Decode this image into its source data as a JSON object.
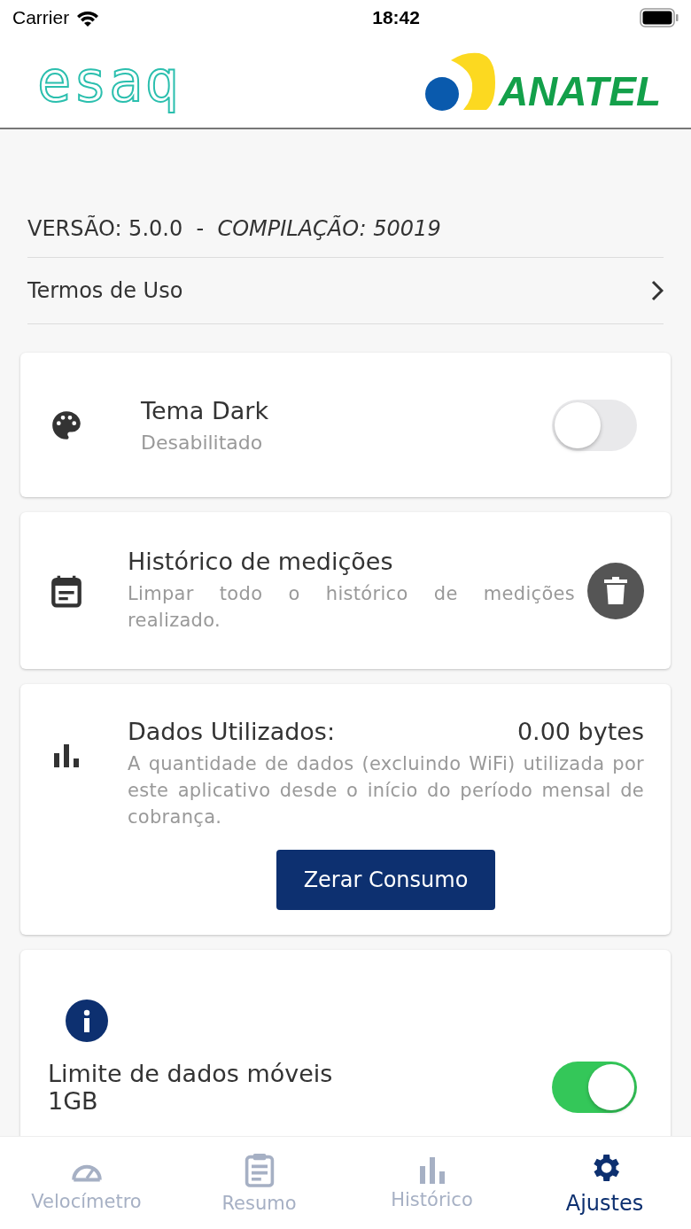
{
  "status_bar": {
    "carrier": "Carrier",
    "time": "18:42"
  },
  "header": {
    "left_logo": "esaq",
    "right_logo": "ANATEL"
  },
  "version": {
    "version": "VERSÃO: 5.0.0",
    "separator": "-",
    "build": "COMPILAÇÃO: 50019"
  },
  "terms": {
    "label": "Termos de Uso"
  },
  "cards": [
    {
      "kind": "toggle",
      "title": "Tema Dark",
      "subtitle": "Desabilitado",
      "on": false
    },
    {
      "kind": "delete",
      "title": "Histórico de medições",
      "description": "Limpar todo o histórico de medições realizado."
    },
    {
      "kind": "data",
      "title": "Dados Utilizados:",
      "value": "0.00 bytes",
      "description": "A quantidade de dados (excluindo WiFi) utilizada por este aplicativo desde o início do período mensal de cobrança.",
      "button": "Zerar Consumo"
    },
    {
      "kind": "limit",
      "title": "Limite de dados móveis",
      "value": "1GB",
      "on": true
    }
  ],
  "tabs": [
    {
      "label": "Velocímetro",
      "selected": false
    },
    {
      "label": "Resumo",
      "selected": false
    },
    {
      "label": "Histórico",
      "selected": false
    },
    {
      "label": "Ajustes",
      "selected": true
    }
  ]
}
